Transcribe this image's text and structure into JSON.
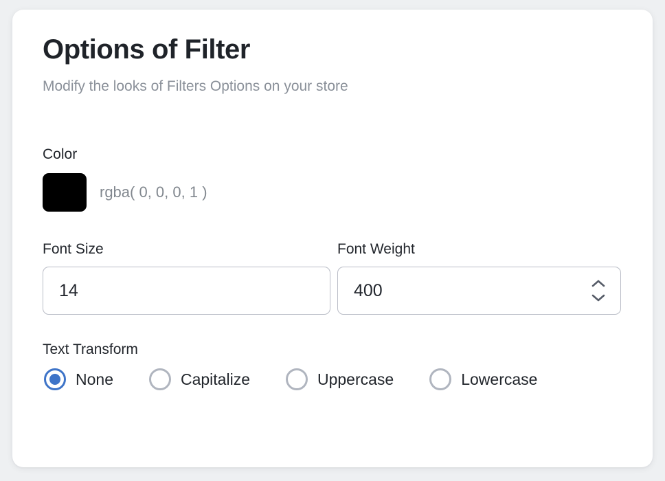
{
  "page": {
    "background_color": "#eef0f2",
    "card_background": "#ffffff"
  },
  "header": {
    "title": "Options of Filter",
    "subtitle": "Modify the looks of Filters Options on your store"
  },
  "color_field": {
    "label": "Color",
    "swatch_color": "#000000",
    "value_text": "rgba( 0, 0, 0, 1 )"
  },
  "font_size_field": {
    "label": "Font Size",
    "value": "14",
    "placeholder": "Font Size"
  },
  "font_weight_field": {
    "label": "Font Weight",
    "value": "400",
    "placeholder": "Font Weight",
    "stepper_icon": "chevron-up-down-icon"
  },
  "text_transform_field": {
    "label": "Text Transform",
    "selected": "None",
    "options": [
      {
        "label": "None",
        "selected": true
      },
      {
        "label": "Capitalize",
        "selected": false
      },
      {
        "label": "Uppercase",
        "selected": false
      },
      {
        "label": "Lowercase",
        "selected": false
      }
    ]
  },
  "colors": {
    "accent": "#3e74c8",
    "radio_off": "#b0b5bf",
    "input_border": "#b9bcc6",
    "muted_text": "#8a9099",
    "body_text": "#22262c"
  }
}
